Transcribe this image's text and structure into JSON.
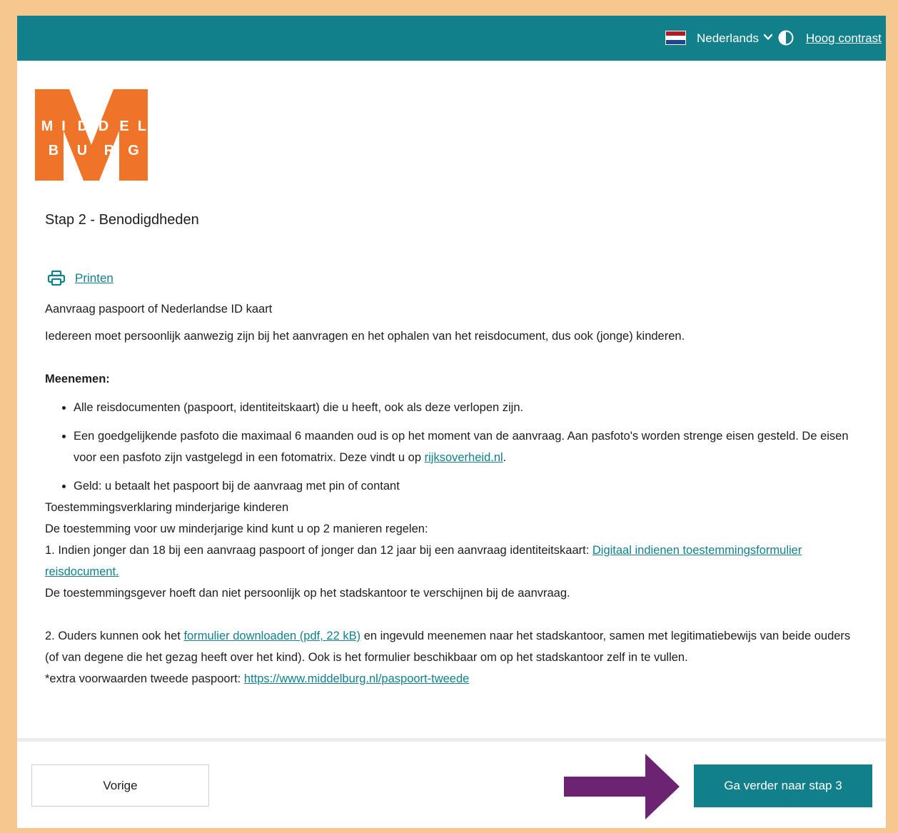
{
  "header": {
    "language": "Nederlands",
    "contrast_label": "Hoog contrast",
    "flag_colors": [
      "#ae1c28",
      "#ffffff",
      "#21468b"
    ],
    "background": "#12808a"
  },
  "logo": {
    "row1": [
      "M",
      "I",
      "D",
      "D",
      "E",
      "L"
    ],
    "row2": [
      "B",
      "U",
      "R",
      "G"
    ],
    "color": "#f07427"
  },
  "page": {
    "step_title": "Stap 2 - Benodigdheden",
    "print_label": "Printen"
  },
  "content": {
    "heading": "Aanvraag paspoort of Nederlandse ID kaart",
    "intro": "Iedereen moet persoonlijk aanwezig zijn bij het aanvragen en het ophalen van het reisdocument, dus ook (jonge) kinderen.",
    "bring_label": "Meenemen:",
    "bullets": {
      "b1": "Alle reisdocumenten (paspoort, identiteitskaart) die u heeft, ook als deze verlopen zijn.",
      "b2_text": "Een goedgelijkende pasfoto die maximaal 6 maanden oud is op het moment van de aanvraag. Aan pasfoto's worden strenge eisen gesteld. De eisen voor een pasfoto zijn vastgelegd in een fotomatrix. Deze vindt u op ",
      "b2_link": "rijksoverheid.nl",
      "b2_end": ".",
      "b3": "Geld: u betaalt het paspoort bij de aanvraag met pin of contant"
    },
    "consent_title": "Toestemmingsverklaring minderjarige kinderen",
    "consent_intro": "De toestemming voor uw minderjarige kind kunt u op 2 manieren regelen:",
    "option1_text": "1. Indien jonger dan 18 bij een aanvraag paspoort of jonger dan 12 jaar bij een aanvraag identiteitskaart: ",
    "option1_link": "Digitaal indienen toestemmingsformulier reisdocument.",
    "option1_note": "De toestemmingsgever hoeft dan niet persoonlijk op het stadskantoor te verschijnen bij de aanvraag.",
    "option2_start": "2. Ouders kunnen ook het ",
    "option2_link": "formulier downloaden (pdf, 22 kB)",
    "option2_end": " en ingevuld meenemen naar het stadskantoor, samen met legitimatiebewijs van beide ouders (of van degene die het gezag heeft over het kind). Ook is het formulier beschikbaar om op het stadskantoor zelf in te vullen.",
    "extra_text": "*extra voorwaarden tweede paspoort: ",
    "extra_link": "https://www.middelburg.nl/paspoort-tweede"
  },
  "footer": {
    "prev_label": "Vorige",
    "next_label": "Ga verder naar stap 3"
  },
  "annotation": {
    "arrow_color": "#6b2372"
  }
}
